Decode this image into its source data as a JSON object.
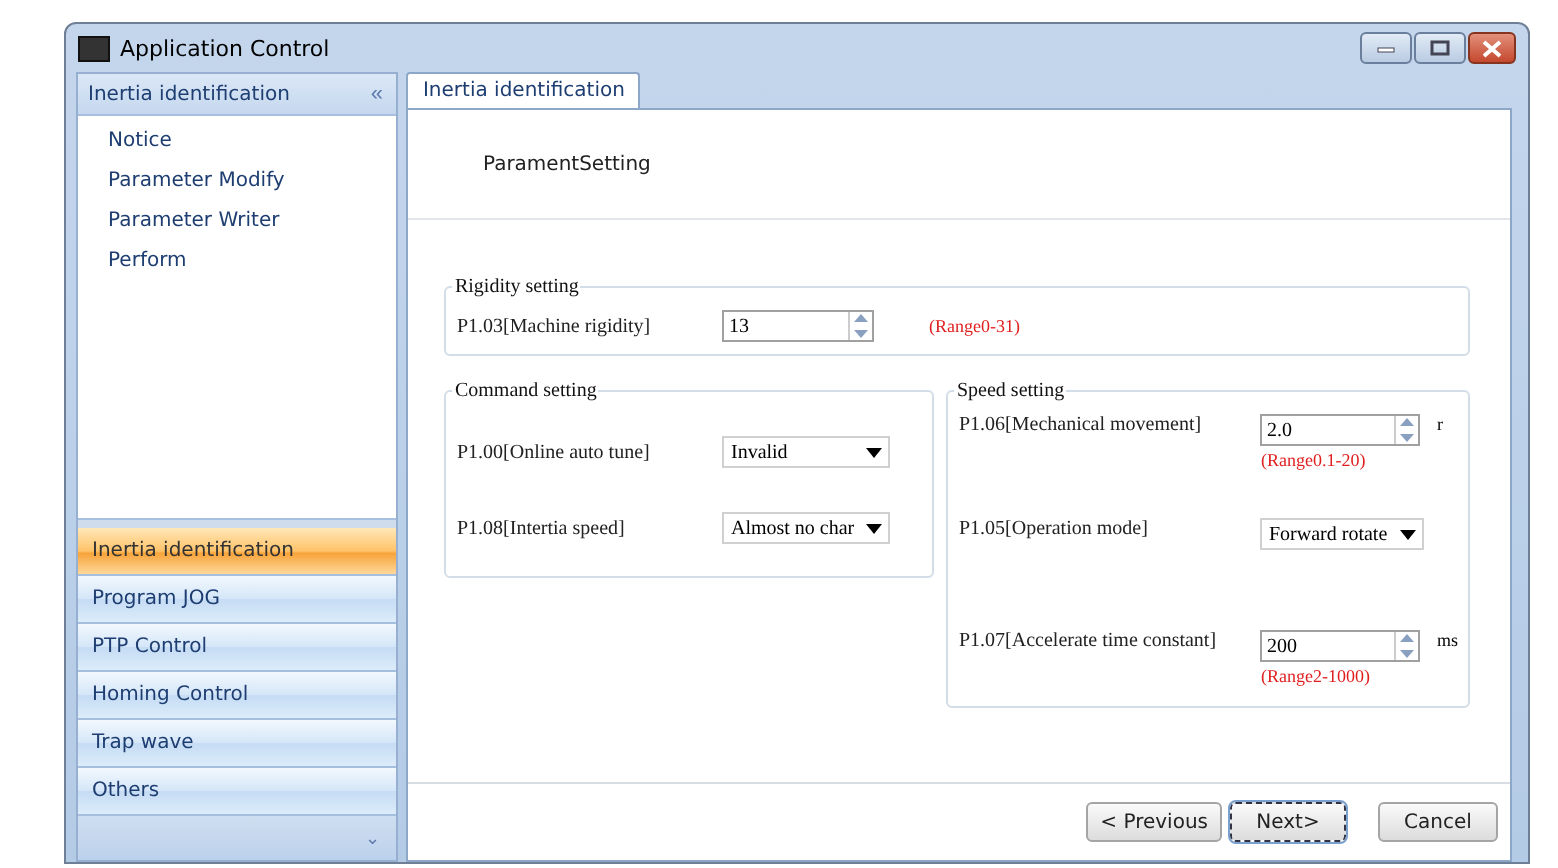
{
  "window": {
    "title": "Application Control"
  },
  "sidebar": {
    "header": "Inertia identification",
    "collapse_glyph": "«",
    "items": [
      {
        "label": "Notice"
      },
      {
        "label": "Parameter Modify"
      },
      {
        "label": "Parameter Writer"
      },
      {
        "label": "Perform"
      }
    ],
    "nav": [
      {
        "label": "Inertia identification",
        "selected": true
      },
      {
        "label": "Program JOG",
        "selected": false
      },
      {
        "label": "PTP Control",
        "selected": false
      },
      {
        "label": "Homing Control",
        "selected": false
      },
      {
        "label": "Trap wave",
        "selected": false
      },
      {
        "label": "Others",
        "selected": false
      }
    ],
    "expand_glyph": "⌄"
  },
  "tabs": [
    {
      "label": "Inertia identification",
      "selected": true
    }
  ],
  "heading": "ParamentSetting",
  "rigidity": {
    "title": "Rigidity setting",
    "fields": [
      {
        "kind": "spin",
        "label": "P1.03[Machine rigidity]",
        "value": "13",
        "range": "(Range0-31)"
      }
    ]
  },
  "command": {
    "title": "Command setting",
    "fields": [
      {
        "kind": "combo",
        "label": "P1.00[Online auto tune]",
        "value": "Invalid"
      },
      {
        "kind": "combo",
        "label": "P1.08[Intertia speed]",
        "value": "Almost no char"
      }
    ]
  },
  "speed": {
    "title": "Speed setting",
    "fields": [
      {
        "kind": "spin",
        "label": "P1.06[Mechanical movement]",
        "value": "2.0",
        "unit": "r",
        "range": "(Range0.1-20)"
      },
      {
        "kind": "combo",
        "label": "P1.05[Operation mode]",
        "value": "Forward rotate"
      },
      {
        "kind": "spin",
        "label": "P1.07[Accelerate time constant]",
        "value": "200",
        "unit": "ms",
        "range": "(Range2-1000)"
      }
    ]
  },
  "buttons": [
    {
      "label": "< Previous",
      "focused": false
    },
    {
      "label": "Next>",
      "focused": true
    },
    {
      "label": "Cancel",
      "focused": false
    }
  ]
}
